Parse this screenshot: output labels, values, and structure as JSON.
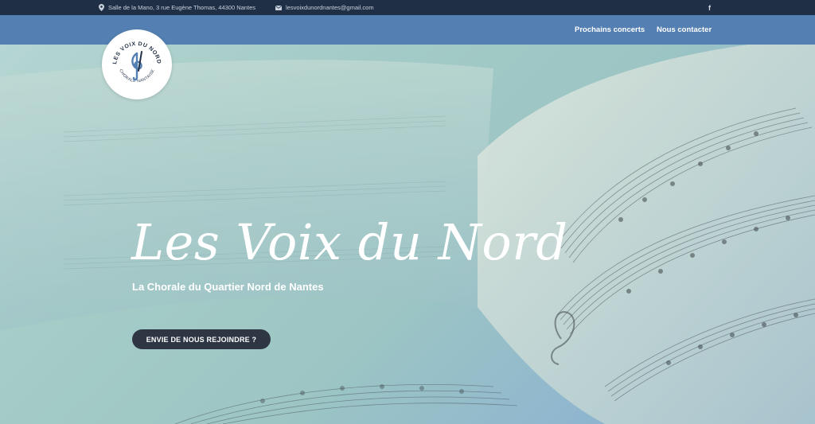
{
  "topbar": {
    "address": "Salle de la Mano, 3 rue Eugène Thomas, 44300 Nantes",
    "email": "lesvoixdunordnantes@gmail.com",
    "facebook": "f"
  },
  "nav": {
    "items": [
      {
        "label": "Prochains concerts"
      },
      {
        "label": "Nous contacter"
      }
    ]
  },
  "logo": {
    "top_text": "LES VOIX DU NORD",
    "bottom_text": "CHORALE NANTAISE"
  },
  "hero": {
    "title": "Les Voix du Nord",
    "subtitle": "La Chorale du Quartier Nord de Nantes",
    "cta_label": "ENVIE DE NOUS REJOINDRE ?"
  },
  "colors": {
    "topbar": "#1f2f45",
    "navbar": "#537fb2",
    "cta": "#2e3644"
  }
}
